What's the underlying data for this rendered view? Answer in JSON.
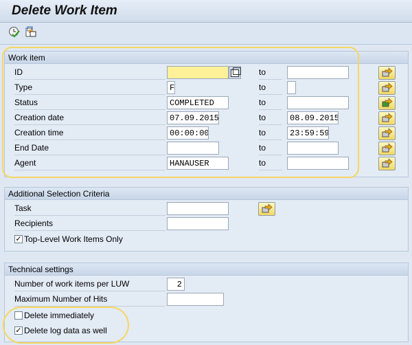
{
  "title": "Delete Work Item",
  "toolbar": {
    "icons": [
      "execute-clock-check-icon",
      "copy-variant-icon"
    ]
  },
  "colors": {
    "required_field": "#fff09a",
    "highlight": "#f6d660",
    "button": "#f2d860"
  },
  "work_item": {
    "heading": "Work item",
    "to_label": "to",
    "rows": [
      {
        "label": "ID",
        "from": "",
        "to": ""
      },
      {
        "label": "Type",
        "from": "F",
        "to": ""
      },
      {
        "label": "Status",
        "from": "COMPLETED",
        "to": ""
      },
      {
        "label": "Creation date",
        "from": "07.09.2015",
        "to": "08.09.2015"
      },
      {
        "label": "Creation time",
        "from": "00:00:00",
        "to": "23:59:59"
      },
      {
        "label": "End Date",
        "from": "",
        "to": ""
      },
      {
        "label": "Agent",
        "from": "HANAUSER",
        "to": ""
      }
    ]
  },
  "additional": {
    "heading": "Additional Selection Criteria",
    "task_label": "Task",
    "task_value": "",
    "recipients_label": "Recipients",
    "recipients_value": "",
    "top_level_label": "Top-Level Work Items Only",
    "top_level_checked": true
  },
  "technical": {
    "heading": "Technical settings",
    "luw_label": "Number of work items per LUW",
    "luw_value": "2",
    "max_hits_label": "Maximum Number of Hits",
    "max_hits_value": "",
    "delete_immediately_label": "Delete immediately",
    "delete_immediately_checked": false,
    "delete_log_label": "Delete log data as well",
    "delete_log_checked": true
  }
}
